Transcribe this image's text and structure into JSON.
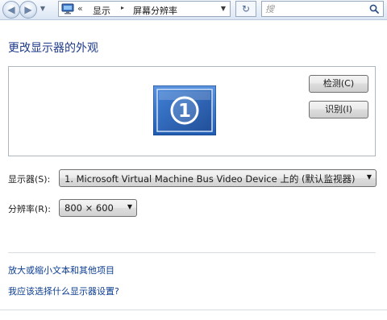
{
  "toolbar": {
    "address": {
      "overflow_glyph": "«",
      "segments": [
        "显示",
        "屏幕分辨率"
      ],
      "separator_glyph": "▸"
    },
    "search": {
      "placeholder": "搜"
    }
  },
  "main": {
    "title": "更改显示器的外观",
    "monitor_number": "1",
    "buttons": {
      "detect": "检测(C)",
      "identify": "识别(I)"
    },
    "display_label": "显示器(S):",
    "display_value": "1. Microsoft Virtual Machine Bus Video Device 上的 (默认监视器)",
    "resolution_label": "分辨率(R):",
    "resolution_value": "800 × 600",
    "links": {
      "text_size": "放大或缩小文本和其他项目",
      "which_settings": "我应该选择什么显示器设置?"
    }
  },
  "colors": {
    "title": "#1e3a8a",
    "link": "#0b3d91",
    "monitor_blue": "#2f6fc4"
  }
}
